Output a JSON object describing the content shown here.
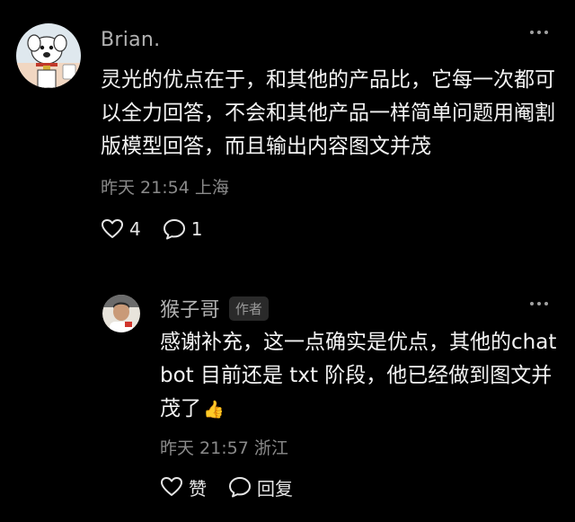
{
  "comments": [
    {
      "username": "Brian.",
      "text": "灵光的优点在于，和其他的产品比，它每一次都可以全力回答，不会和其他产品一样简单问题用阉割版模型回答，而且输出内容图文并茂",
      "meta": "昨天 21:54 上海",
      "likes": "4",
      "replies": "1",
      "avatar_icon": "cartoon-dog-avatar"
    },
    {
      "username": "猴子哥",
      "badge": "作者",
      "text": "感谢补充，这一点确实是优点，其他的chatbot 目前还是 txt 阶段，他已经做到图文并茂了",
      "emoji": "👍",
      "meta": "昨天 21:57 浙江",
      "like_label": "赞",
      "reply_label": "回复",
      "avatar_icon": "person-photo-avatar"
    }
  ],
  "colors": {
    "background": "#000000",
    "username": "#b3b3b3",
    "text": "#f3f3f3",
    "meta": "#8a8a8a"
  }
}
